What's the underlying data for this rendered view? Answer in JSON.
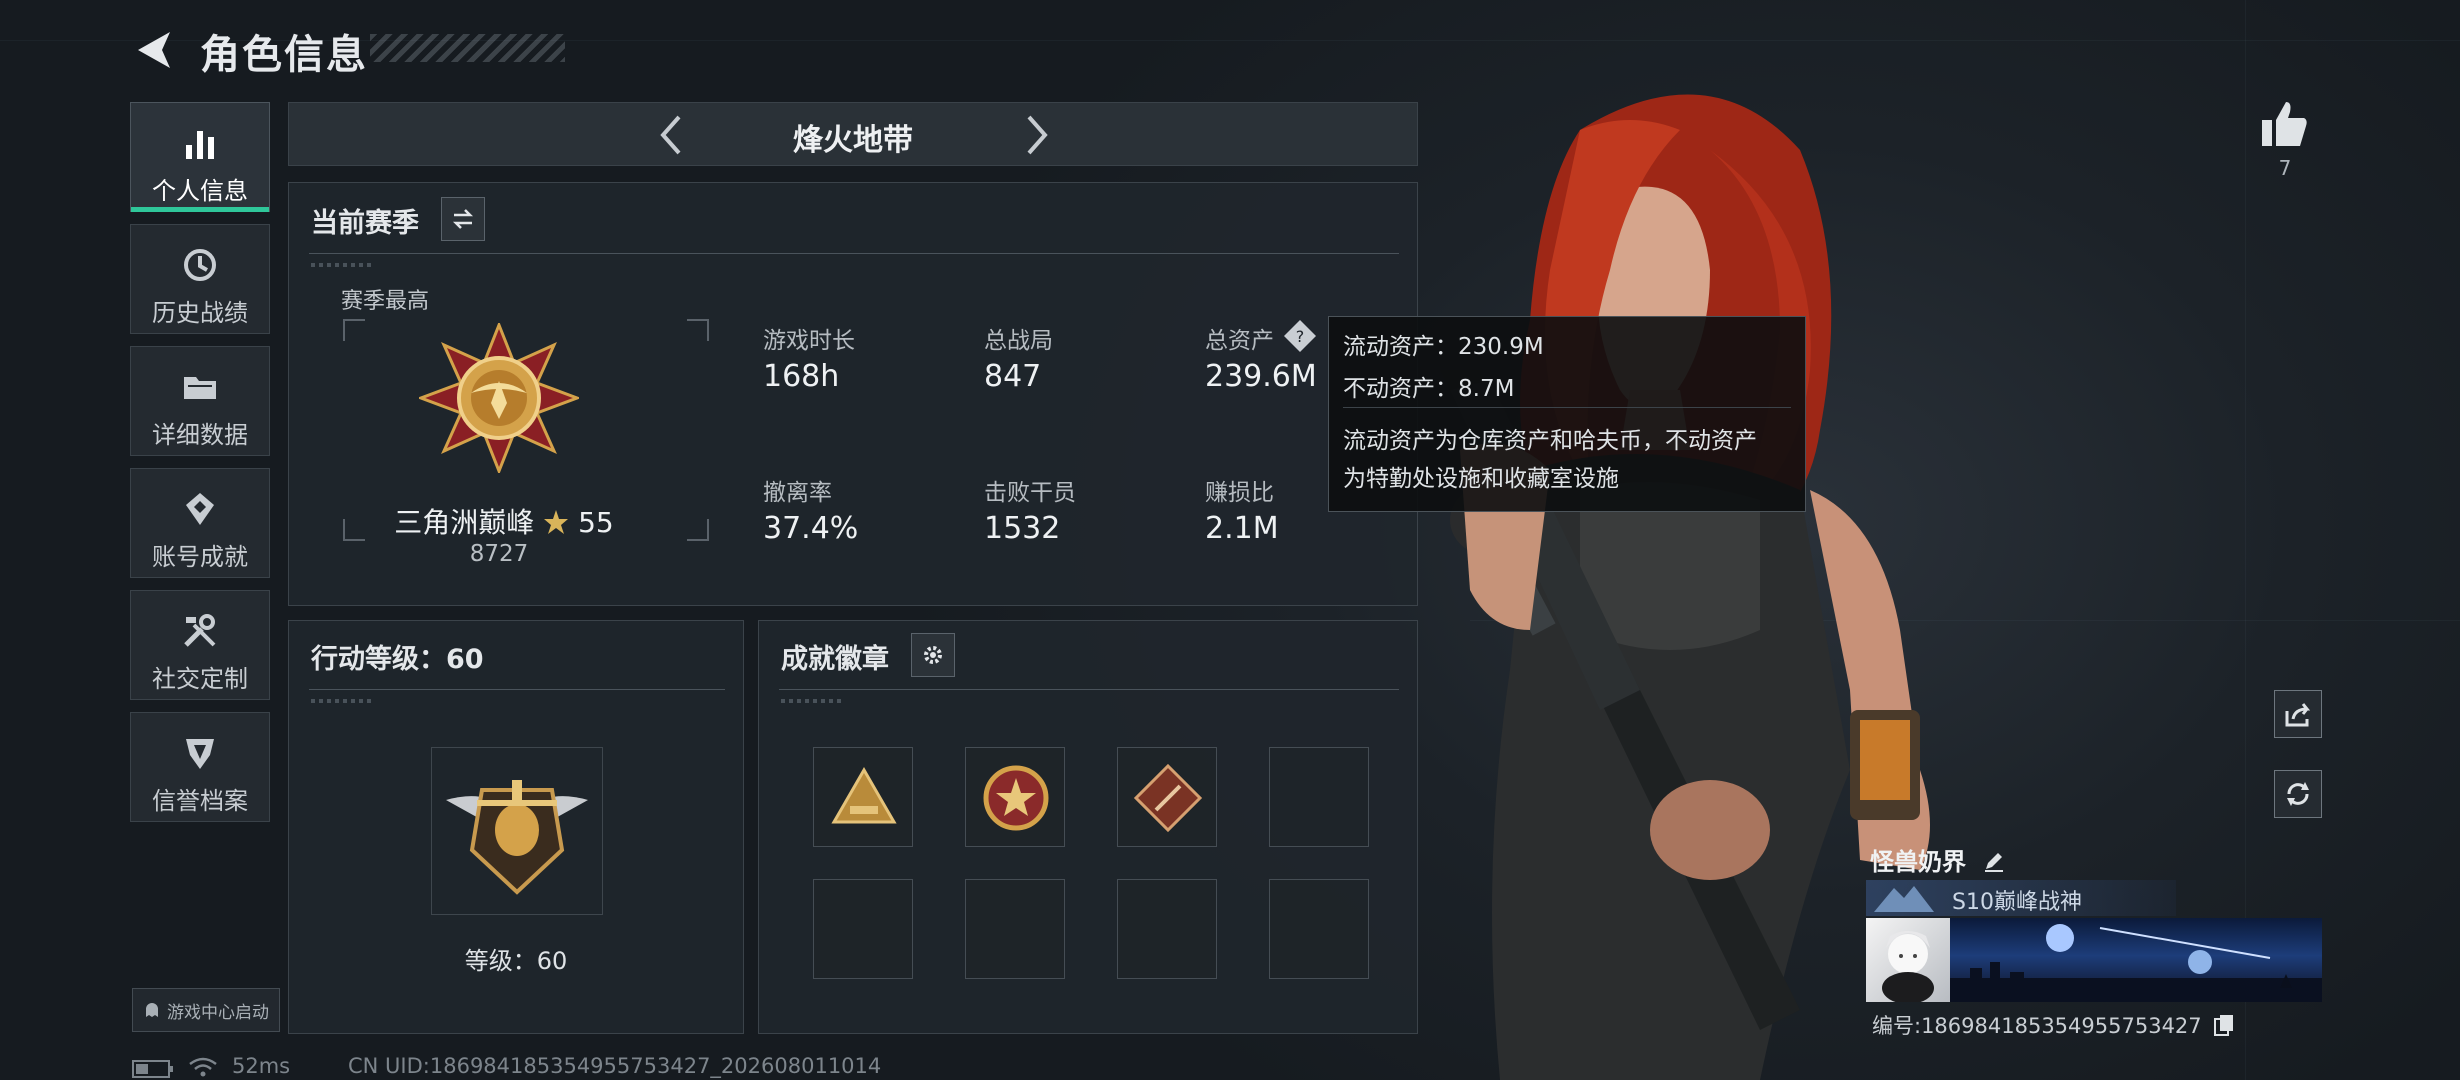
{
  "header": {
    "title": "角色信息"
  },
  "sidebar": {
    "items": [
      {
        "label": "个人信息",
        "icon": "bar-chart-icon",
        "active": true
      },
      {
        "label": "历史战绩",
        "icon": "history-icon",
        "active": false
      },
      {
        "label": "详细数据",
        "icon": "folder-icon",
        "active": false
      },
      {
        "label": "账号成就",
        "icon": "achievement-icon",
        "active": false
      },
      {
        "label": "社交定制",
        "icon": "tools-icon",
        "active": false
      },
      {
        "label": "信誉档案",
        "icon": "shield-icon",
        "active": false
      }
    ],
    "game_center": "游戏中心启动"
  },
  "mode": {
    "title": "烽火地带"
  },
  "season": {
    "title": "当前赛季",
    "best_label": "赛季最高",
    "rank_name": "三角洲巅峰",
    "rank_stars": "55",
    "rank_score": "8727",
    "stats": [
      {
        "label": "游戏时长",
        "value": "168h"
      },
      {
        "label": "总战局",
        "value": "847"
      },
      {
        "label": "总资产",
        "value": "239.6M"
      },
      {
        "label": "撤离率",
        "value": "37.4%"
      },
      {
        "label": "击败干员",
        "value": "1532"
      },
      {
        "label": "赚损比",
        "value": "2.1M"
      }
    ]
  },
  "tooltip": {
    "liquid": "流动资产：230.9M",
    "fixed": "不动资产：8.7M",
    "desc_line1": "流动资产为仓库资产和哈夫币，不动资产",
    "desc_line2": "为特勤处设施和收藏室设施"
  },
  "level": {
    "title": "行动等级：60",
    "label": "等级：60"
  },
  "badges": {
    "title": "成就徽章",
    "filled": 3,
    "total": 8
  },
  "social": {
    "like_count": "7"
  },
  "player": {
    "name": "怪兽奶界",
    "title": "S10巅峰战神",
    "id": "编号:1869841853549557534​27"
  },
  "footer": {
    "ping": "52ms",
    "uid": "CN UID:1869841853549557534​27_202608011014"
  },
  "colors": {
    "accent": "#2fc79a",
    "hair": "#b8301c",
    "gold": "#d4a24a"
  }
}
